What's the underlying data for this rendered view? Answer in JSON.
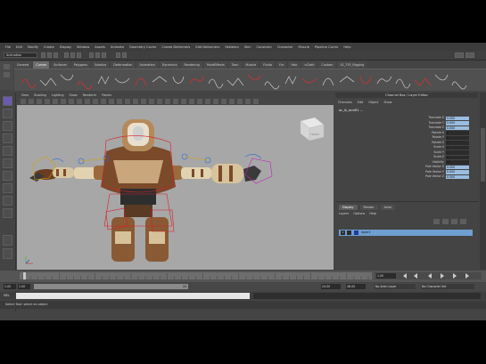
{
  "menubar": [
    "File",
    "Edit",
    "Modify",
    "Create",
    "Display",
    "Window",
    "Assets",
    "Animate",
    "Geometry Cache",
    "Create Deformers",
    "Edit Deformers",
    "Skeleton",
    "Skin",
    "Constrain",
    "Character",
    "Muscle",
    "Pipeline Cache",
    "Help"
  ],
  "statusline": {
    "mode": "Animation"
  },
  "shelf": {
    "tabs": [
      "General",
      "Curves",
      "Surfaces",
      "Polygons",
      "Subdivs",
      "Deformation",
      "Animation",
      "Dynamics",
      "Rendering",
      "PaintEffects",
      "Toon",
      "Muscle",
      "Fluids",
      "Fur",
      "Hair",
      "nCloth",
      "Custom",
      "01_TSF_Rigging"
    ],
    "active_tab": "Curves"
  },
  "viewport": {
    "menu": [
      "View",
      "Shading",
      "Lighting",
      "Show",
      "Renderer",
      "Panels"
    ],
    "view_cube_label": "FRONT"
  },
  "channel_box": {
    "title": "Channel Box / Layer Editor",
    "menu": [
      "Channels",
      "Edit",
      "Object",
      "Show"
    ],
    "object_name": "ac_ik_armR1 ...",
    "attributes": [
      {
        "label": "Translate X",
        "value": "0.000",
        "highlight": true
      },
      {
        "label": "Translate Y",
        "value": "0.000",
        "highlight": true
      },
      {
        "label": "Translate Z",
        "value": "0.000",
        "highlight": true
      },
      {
        "label": "Rotate X",
        "value": "0",
        "highlight": false
      },
      {
        "label": "Rotate Y",
        "value": "0",
        "highlight": false
      },
      {
        "label": "Rotate Z",
        "value": "0",
        "highlight": false
      },
      {
        "label": "Scale X",
        "value": "1",
        "highlight": false
      },
      {
        "label": "Scale Y",
        "value": "1",
        "highlight": false
      },
      {
        "label": "Scale Z",
        "value": "1",
        "highlight": false
      },
      {
        "label": "Visibility",
        "value": "on",
        "highlight": false
      },
      {
        "label": "Pole Vector X",
        "value": "0.000",
        "highlight": true
      },
      {
        "label": "Pole Vector Y",
        "value": "0.000",
        "highlight": true
      },
      {
        "label": "Pole Vector Z",
        "value": "0.000",
        "highlight": true
      }
    ]
  },
  "layers": {
    "tabs": [
      "Display",
      "Render",
      "Anim"
    ],
    "active_tab": "Display",
    "menu": [
      "Layers",
      "Options",
      "Help"
    ],
    "rows": [
      {
        "visible": "V",
        "name": "layer1",
        "color": "#223a9a"
      }
    ]
  },
  "range": {
    "start": "1.00",
    "inner_start": "1.00",
    "slider_label": "24",
    "inner_end": "24.00",
    "end": "48.00",
    "anim_layer": "No Anim Layer",
    "char_set": "No Character Set"
  },
  "timeline": {
    "current_frame": "1.00"
  },
  "cmdline": {
    "label": "MEL"
  },
  "helpline": "Select Tool: select an object",
  "colors": {
    "viewport_bg": "#a7a7a7",
    "selection": "#6e9fd0",
    "ik_handle": "#d81e2c"
  }
}
